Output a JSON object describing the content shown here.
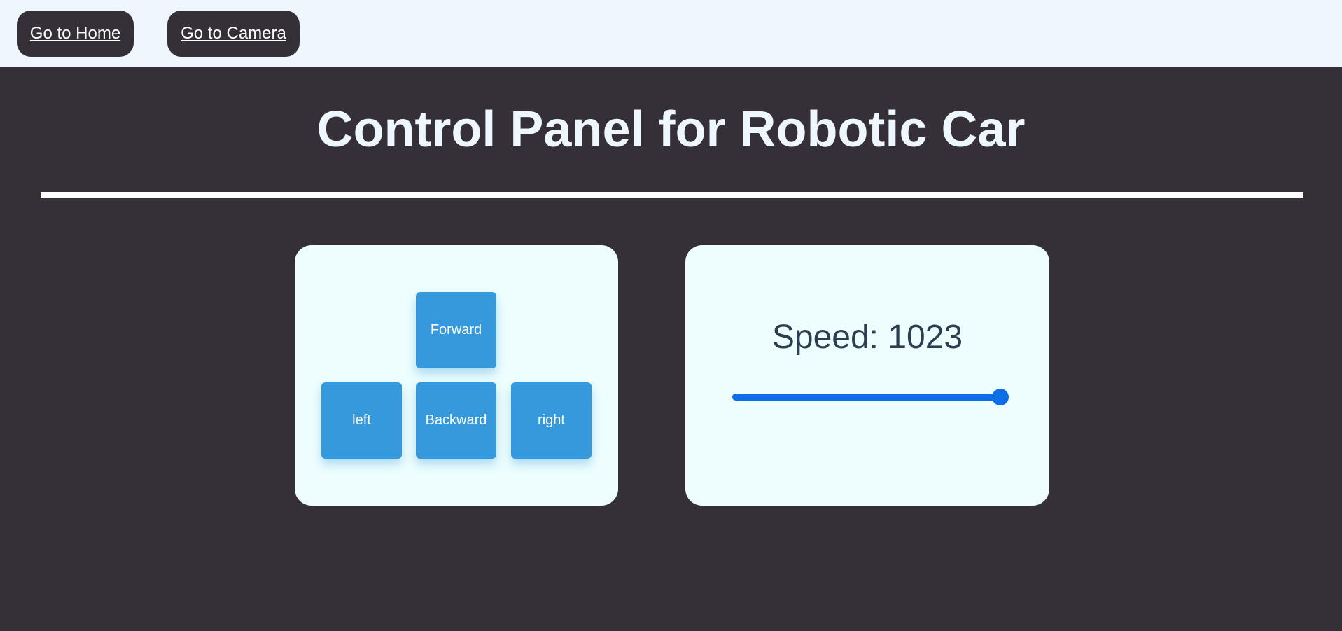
{
  "nav": {
    "home_label": "Go to Home",
    "camera_label": "Go to Camera"
  },
  "header": {
    "title": "Control Panel for Robotic Car"
  },
  "dpad": {
    "forward_label": "Forward",
    "left_label": "left",
    "backward_label": "Backward",
    "right_label": "right"
  },
  "speed": {
    "label": "Speed: ",
    "value": "1023",
    "slider_fraction": 1.0
  },
  "colors": {
    "background": "#353038",
    "topbar": "#eef6fe",
    "card": "#eefefe",
    "button": "#3699db",
    "slider": "#0d6ee8",
    "speed_text": "#2c3e50"
  }
}
